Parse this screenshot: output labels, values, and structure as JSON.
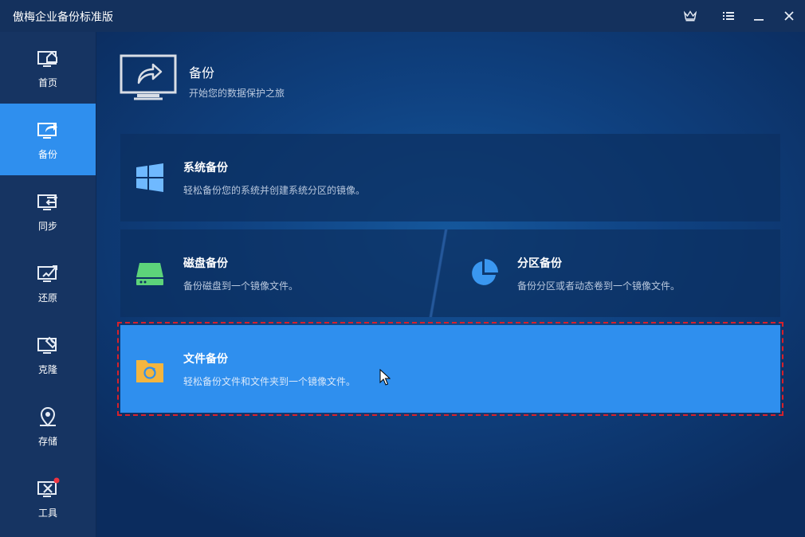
{
  "app": {
    "title": "傲梅企业备份标准版",
    "window_buttons": [
      {
        "name": "upgrade-crown-icon"
      },
      {
        "name": "menu-icon"
      },
      {
        "name": "minimize-icon"
      },
      {
        "name": "close-icon"
      }
    ]
  },
  "sidebar": {
    "active_index": 1,
    "items": [
      {
        "label": "首页",
        "icon": "home-monitor-icon"
      },
      {
        "label": "备份",
        "icon": "backup-monitor-icon"
      },
      {
        "label": "同步",
        "icon": "sync-monitor-icon"
      },
      {
        "label": "还原",
        "icon": "restore-monitor-icon"
      },
      {
        "label": "克隆",
        "icon": "clone-monitor-icon"
      },
      {
        "label": "存储",
        "icon": "storage-location-icon"
      },
      {
        "label": "工具",
        "icon": "tools-icon"
      }
    ]
  },
  "header": {
    "title": "备份",
    "subtitle": "开始您的数据保护之旅"
  },
  "cards": {
    "system": {
      "title": "系统备份",
      "desc": "轻松备份您的系统并创建系统分区的镜像。",
      "icon": "windows-icon"
    },
    "disk": {
      "title": "磁盘备份",
      "desc": "备份磁盘到一个镜像文件。",
      "icon": "disk-drive-icon"
    },
    "partition": {
      "title": "分区备份",
      "desc": "备份分区或者动态卷到一个镜像文件。",
      "icon": "pie-partition-icon"
    },
    "file": {
      "title": "文件备份",
      "desc": "轻松备份文件和文件夹到一个镜像文件。",
      "icon": "folder-backup-icon"
    }
  },
  "colors": {
    "accent": "#2f8fee",
    "sidebar_bg": "#163462",
    "highlight_outline": "#d8202a",
    "disk_icon": "#5dd47a",
    "file_icon": "#f3b53f",
    "partition_icon": "#3a97f0"
  }
}
